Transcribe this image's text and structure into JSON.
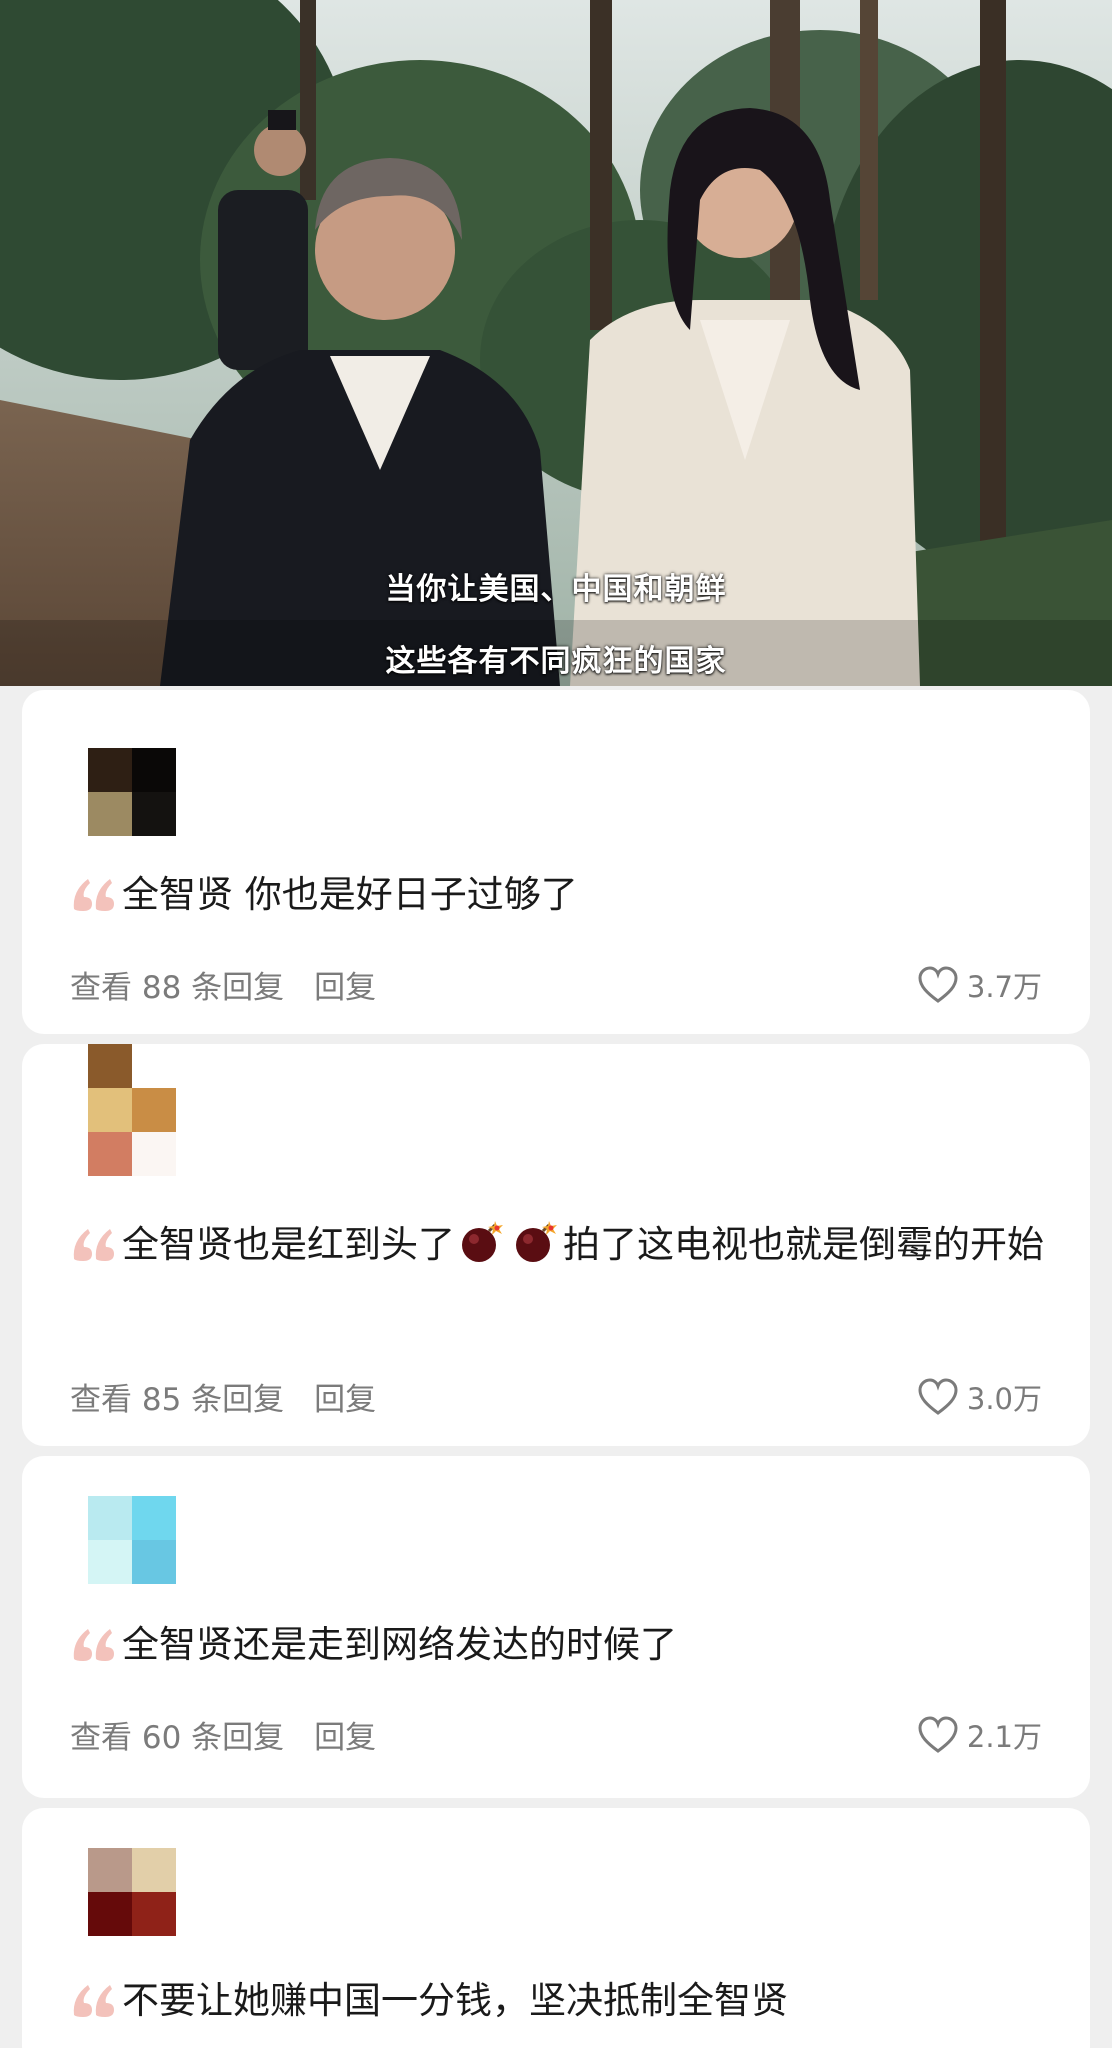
{
  "video": {
    "subtitle_line1": "当你让美国、中国和朝鲜",
    "subtitle_line2": "这些各有不同疯狂的国家"
  },
  "comments": [
    {
      "text": "全智贤 你也是好日子过够了",
      "replies_label": "查看 88 条回复",
      "reply_label": "回复",
      "likes": "3.7万",
      "avatar_colors": [
        "#2e1f14",
        "#0a0807",
        "#9c8a62",
        "#141210"
      ]
    },
    {
      "text_before_emoji": "全智贤也是红到头了",
      "emoji": [
        "bomb-icon",
        "bomb-icon"
      ],
      "text_after_emoji": "拍了这电视也就是倒霉的开始",
      "replies_label": "查看 85 条回复",
      "reply_label": "回复",
      "likes": "3.0万",
      "avatar_colors": [
        "#e2c07b",
        "#c98d45",
        "#d27d62",
        "#fbf6f3"
      ]
    },
    {
      "text": "全智贤还是走到网络发达的时候了",
      "replies_label": "查看 60 条回复",
      "reply_label": "回复",
      "likes": "2.1万",
      "avatar_colors": [
        "#b9eaf0",
        "#6fd7ee",
        "#d4f5f5",
        "#68c7e3"
      ]
    },
    {
      "text": "不要让她赚中国一分钱，坚决抵制全智贤",
      "avatar_colors": [
        "#b9998a",
        "#e2cfa9",
        "#650a0a",
        "#8f2218"
      ]
    }
  ],
  "colors": {
    "quote_mark": "#f3c2bb",
    "meta_text": "#7b7b7b",
    "comment_text": "#1a1a1a"
  }
}
